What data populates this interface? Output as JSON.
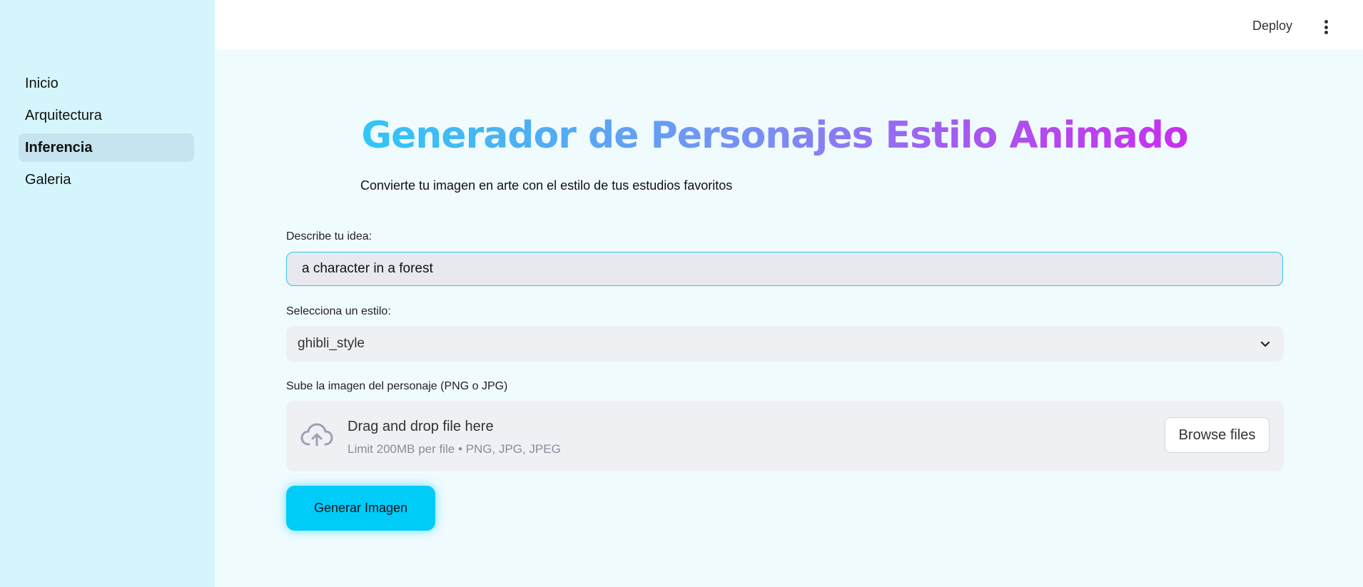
{
  "sidebar": {
    "items": [
      {
        "label": "Inicio",
        "active": false
      },
      {
        "label": "Arquitectura",
        "active": false
      },
      {
        "label": "Inferencia",
        "active": true
      },
      {
        "label": "Galeria",
        "active": false
      }
    ]
  },
  "topbar": {
    "deploy_label": "Deploy",
    "menu_icon": "kebab-menu-icon"
  },
  "main": {
    "title": "Generador de Personajes Estilo Animado",
    "subtitle": "Convierte tu imagen en arte con el estilo de tus estudios favoritos",
    "idea": {
      "label": "Describe tu idea:",
      "value": "a character in a forest"
    },
    "style": {
      "label": "Selecciona un estilo:",
      "selected": "ghibli_style",
      "icon": "chevron-down-icon"
    },
    "upload": {
      "label": "Sube la imagen del personaje (PNG o JPG)",
      "title": "Drag and drop file here",
      "limits": "Limit 200MB per file • PNG, JPG, JPEG",
      "browse_label": "Browse files",
      "icon": "cloud-upload-icon"
    },
    "generate_label": "Generar Imagen"
  },
  "colors": {
    "accent": "#00ccfa",
    "sidebar_bg": "#d5f5fd",
    "main_bg": "#f0fbfe",
    "title_gradient": [
      "#2fc7f5",
      "#7c8cf3",
      "#a955f0",
      "#c92ff0"
    ]
  }
}
